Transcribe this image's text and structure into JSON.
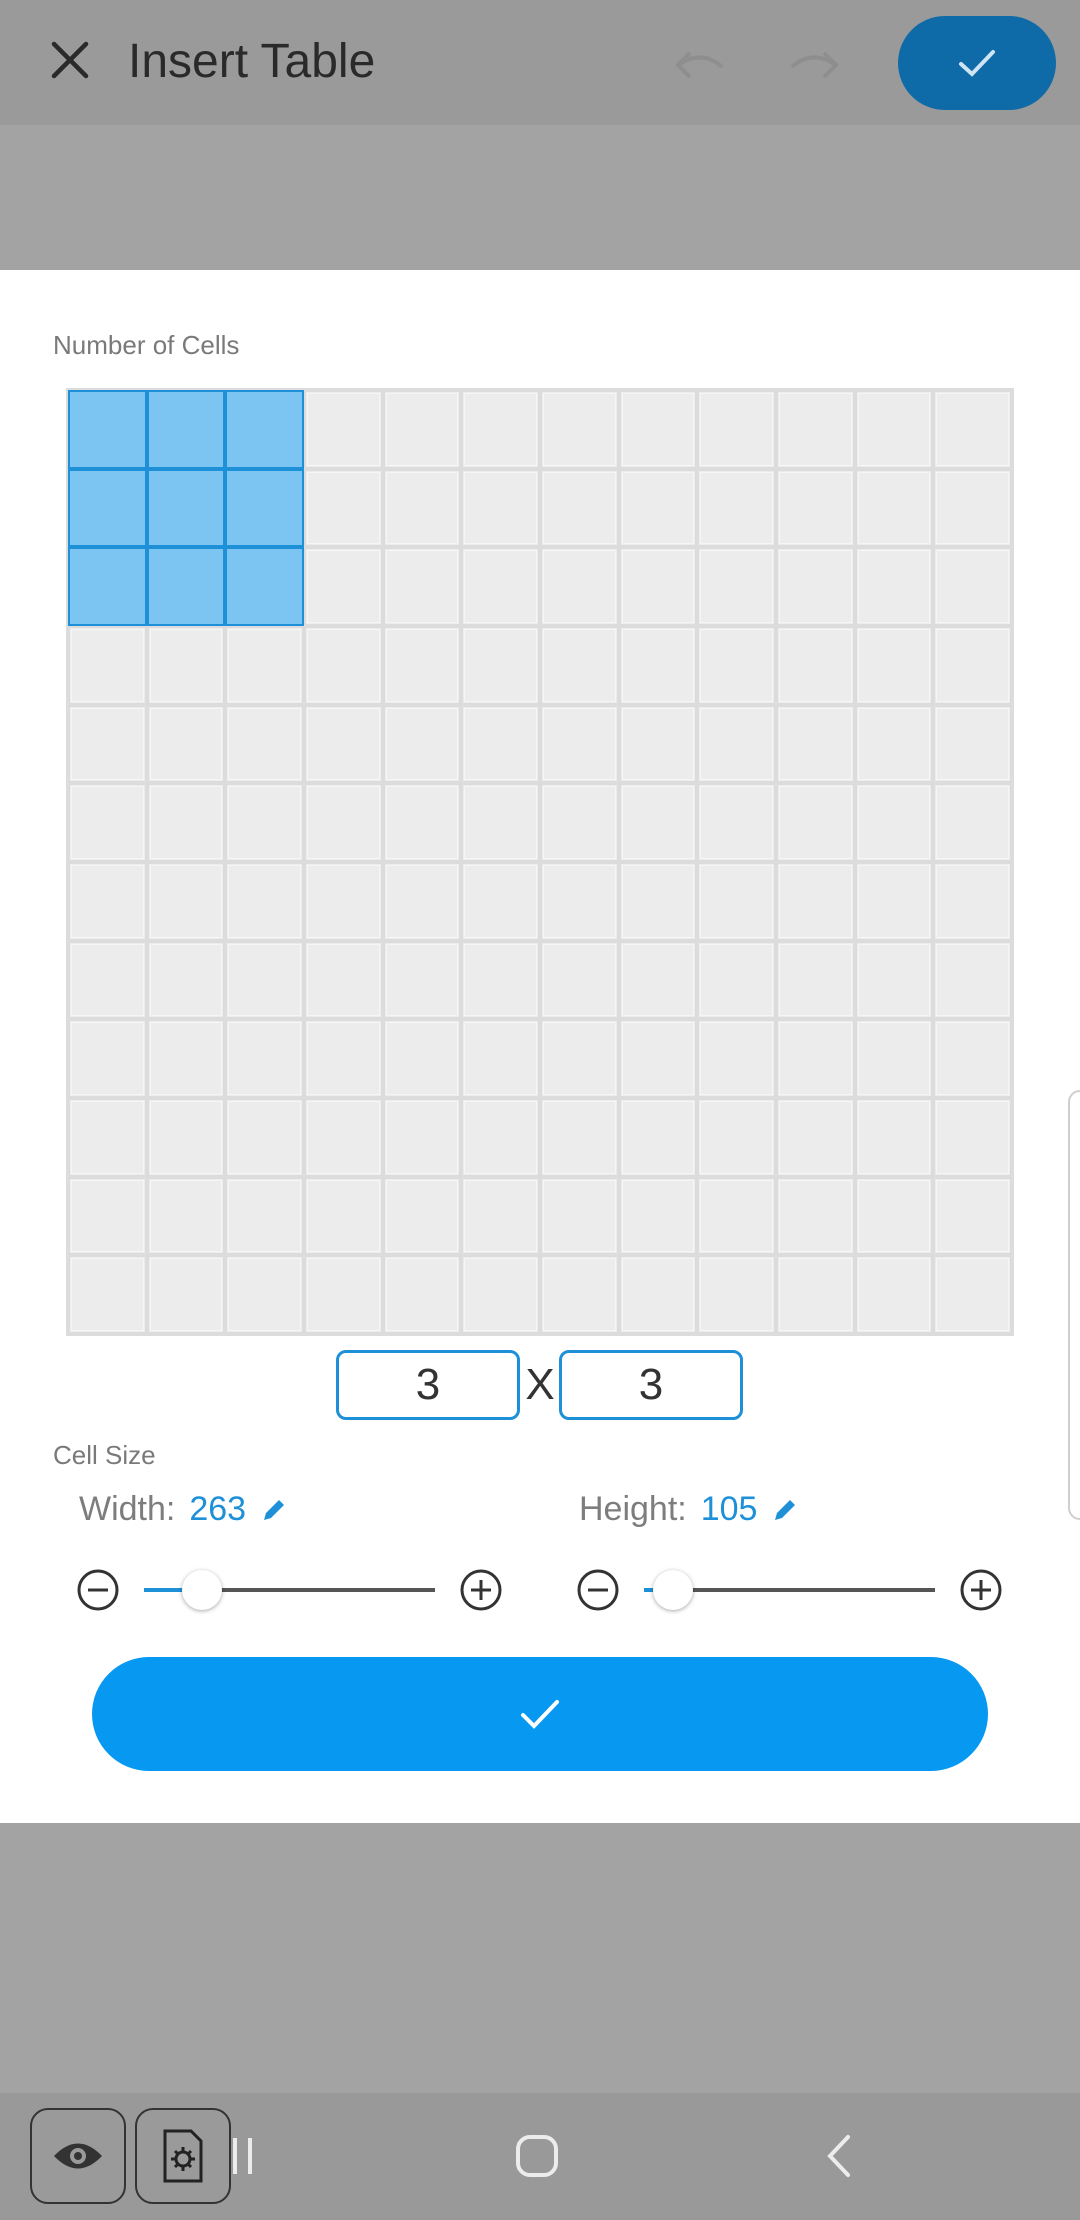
{
  "appbar": {
    "title": "Insert Table",
    "close_icon": "close-icon",
    "undo_icon": "undo-icon",
    "redo_icon": "redo-icon",
    "confirm_icon": "check-icon"
  },
  "dialog": {
    "cells_label": "Number of Cells",
    "grid": {
      "total_rows": 12,
      "total_cols": 12,
      "selected_rows": 3,
      "selected_cols": 3
    },
    "rows_value": "3",
    "times_label": "X",
    "cols_value": "3",
    "cell_size_label": "Cell Size",
    "width_label": "Width:",
    "width_value": "263",
    "height_label": "Height:",
    "height_value": "105",
    "width_slider_level": 0.2,
    "height_slider_level": 0.1,
    "ok_icon": "check-icon"
  },
  "colors": {
    "accent": "#0799f2",
    "selection_fill": "#7cc4f2",
    "selection_border": "#1e90d8"
  },
  "nav": {
    "recents_icon": "recents-icon",
    "home_icon": "home-icon",
    "back_icon": "back-icon"
  },
  "floating_tools": {
    "preview_icon": "eye-icon",
    "doc_settings_icon": "document-settings-icon"
  }
}
